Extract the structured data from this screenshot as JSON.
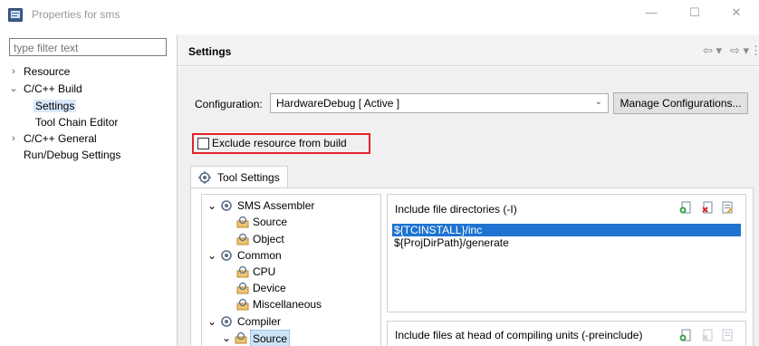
{
  "window": {
    "title": "Properties for sms",
    "minimize": "—",
    "maximize": "☐",
    "close": "✕"
  },
  "filter": {
    "placeholder": "type filter text"
  },
  "nav_tree": [
    {
      "label": "Resource",
      "arrow": "›"
    },
    {
      "label": "C/C++ Build",
      "arrow": "⌄"
    },
    {
      "label": "Settings"
    },
    {
      "label": "Tool Chain Editor"
    },
    {
      "label": "C/C++ General",
      "arrow": "›"
    },
    {
      "label": "Run/Debug Settings"
    }
  ],
  "header": {
    "title": "Settings",
    "back": "⇦ ▾",
    "forward": "⇨ ▾",
    "menu": "⋮"
  },
  "configuration": {
    "label": "Configuration:",
    "value": "HardwareDebug  [ Active ]",
    "manage_label": "Manage Configurations..."
  },
  "exclude": {
    "label": "Exclude resource from build",
    "checked": false
  },
  "tab": {
    "label": "Tool Settings"
  },
  "tool_tree": [
    {
      "label": "SMS Assembler",
      "arrow": "⌄"
    },
    {
      "label": "Source"
    },
    {
      "label": "Object"
    },
    {
      "label": "Common",
      "arrow": "⌄"
    },
    {
      "label": "CPU"
    },
    {
      "label": "Device"
    },
    {
      "label": "Miscellaneous"
    },
    {
      "label": "Compiler",
      "arrow": "⌄"
    },
    {
      "label": "Source",
      "arrow": "⌄"
    }
  ],
  "include_dirs": {
    "title": "Include file directories (-I)",
    "items": [
      "${TCINSTALL}/inc",
      "${ProjDirPath}/generate"
    ]
  },
  "preinclude": {
    "title": "Include files at head of compiling units (-preinclude)"
  },
  "colors": {
    "highlight_border": "#e0232b",
    "selection": "#1e74d0"
  }
}
